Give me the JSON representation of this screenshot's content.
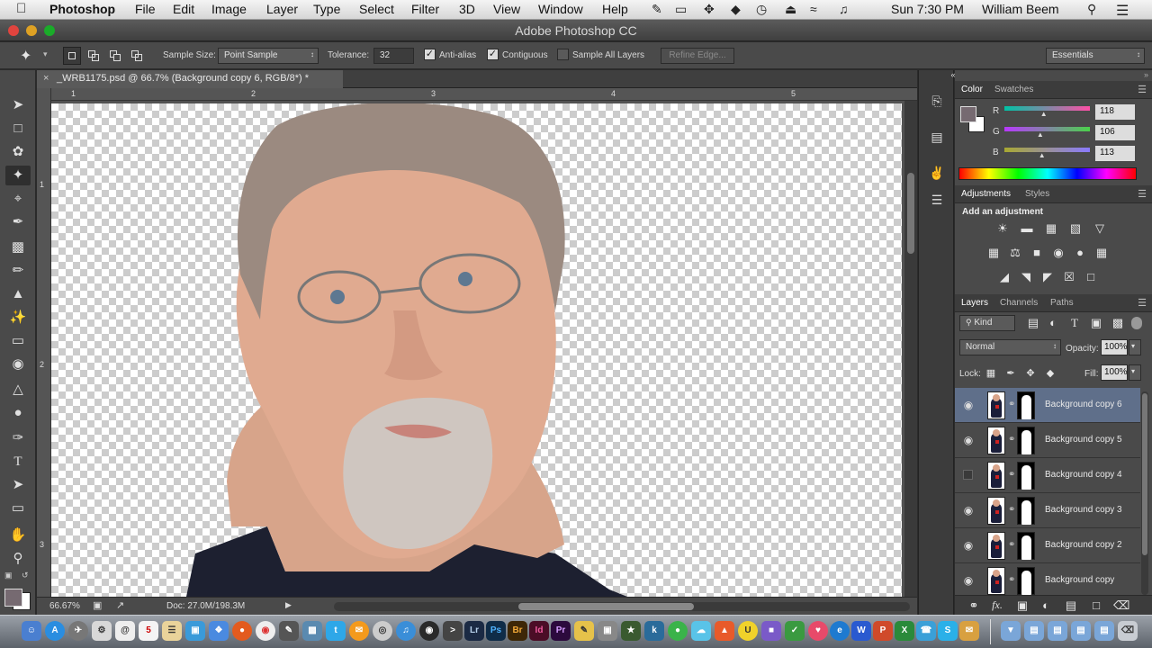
{
  "menubar": {
    "app_name": "Photoshop",
    "items": [
      "File",
      "Edit",
      "Image",
      "Layer",
      "Type",
      "Select",
      "Filter",
      "3D",
      "View",
      "Window",
      "Help"
    ],
    "clock": "Sun 7:30 PM",
    "user": "William Beem"
  },
  "window": {
    "title": "Adobe Photoshop CC"
  },
  "options": {
    "sample_size_label": "Sample Size:",
    "sample_size_value": "Point Sample",
    "tolerance_label": "Tolerance:",
    "tolerance_value": "32",
    "anti_alias": "Anti-alias",
    "contiguous": "Contiguous",
    "sample_all": "Sample All Layers",
    "refine_edge": "Refine Edge...",
    "workspace": "Essentials"
  },
  "document": {
    "tab_title": "_WRB1175.psd @ 66.7% (Background copy 6, RGB/8*) *",
    "close": "×",
    "hruler_ticks": [
      "1",
      "2",
      "3",
      "4",
      "5"
    ],
    "vruler_ticks": [
      "1",
      "2",
      "3"
    ],
    "zoom": "66.67%",
    "doc_size": "Doc: 27.0M/198.3M"
  },
  "color_panel": {
    "tabs": [
      "Color",
      "Swatches"
    ],
    "fg_color": "#766a71",
    "channels": [
      {
        "label": "R",
        "value": "118",
        "fill": 0.46
      },
      {
        "label": "G",
        "value": "106",
        "fill": 0.42
      },
      {
        "label": "B",
        "value": "113",
        "fill": 0.44
      }
    ]
  },
  "adjustments_panel": {
    "tabs": [
      "Adjustments",
      "Styles"
    ],
    "heading": "Add an adjustment"
  },
  "layers_panel": {
    "tabs": [
      "Layers",
      "Channels",
      "Paths"
    ],
    "filter": "Kind",
    "blend_mode": "Normal",
    "opacity_label": "Opacity:",
    "opacity_value": "100%",
    "lock_label": "Lock:",
    "fill_label": "Fill:",
    "fill_value": "100%",
    "layers": [
      {
        "name": "Background copy 6",
        "visible": true,
        "selected": true
      },
      {
        "name": "Background copy 5",
        "visible": true,
        "selected": false
      },
      {
        "name": "Background copy 4",
        "visible": false,
        "selected": false
      },
      {
        "name": "Background copy 3",
        "visible": true,
        "selected": false
      },
      {
        "name": "Background copy 2",
        "visible": true,
        "selected": false
      },
      {
        "name": "Background copy",
        "visible": true,
        "selected": false
      }
    ],
    "footer_fx": "fx."
  },
  "dock": {
    "labeled": [
      "Lr",
      "Ps",
      "Br",
      "Id",
      "Pr"
    ]
  }
}
